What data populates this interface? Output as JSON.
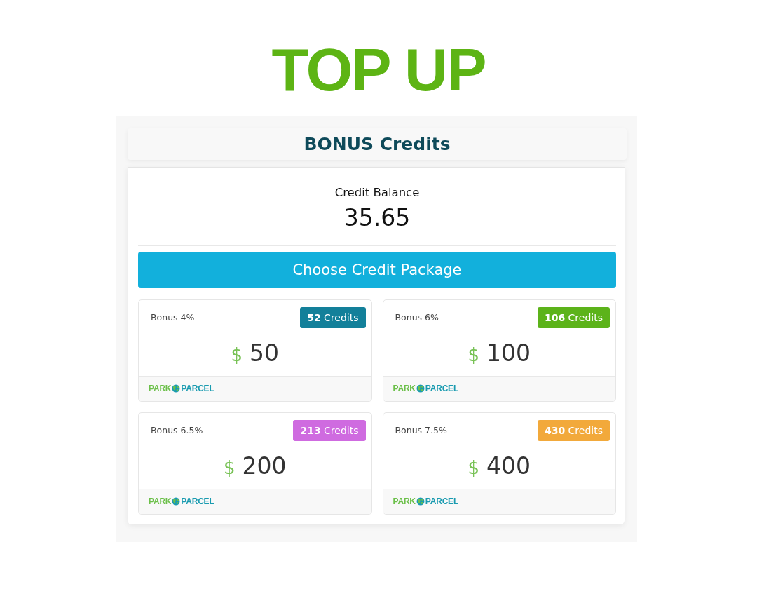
{
  "page": {
    "title": "TOP UP"
  },
  "panel": {
    "heading": "BONUS Credits",
    "balance_label": "Credit Balance",
    "balance": "35.65",
    "choose_button": "Choose Credit Package"
  },
  "packages": [
    {
      "bonus": "Bonus 4%",
      "credits": "**52** Credits",
      "color": "#13809a",
      "currency": "$",
      "amount": "50",
      "logo": [
        "PARK",
        "PARCEL"
      ]
    },
    {
      "bonus": "Bonus 6%",
      "credits": "**106** Credits",
      "color": "#5cb31a",
      "currency": "$",
      "amount": "100",
      "logo": [
        "PARK",
        "PARCEL"
      ]
    },
    {
      "bonus": "Bonus 6.5%",
      "credits": "**213** Credits",
      "color": "#cf6be0",
      "currency": "$",
      "amount": "200",
      "logo": [
        "PARK",
        "PARCEL"
      ]
    },
    {
      "bonus": "Bonus 7.5%",
      "credits": "**430** Credits",
      "color": "#f2a93b",
      "currency": "$",
      "amount": "400",
      "logo": [
        "PARK",
        "PARCEL"
      ]
    }
  ]
}
